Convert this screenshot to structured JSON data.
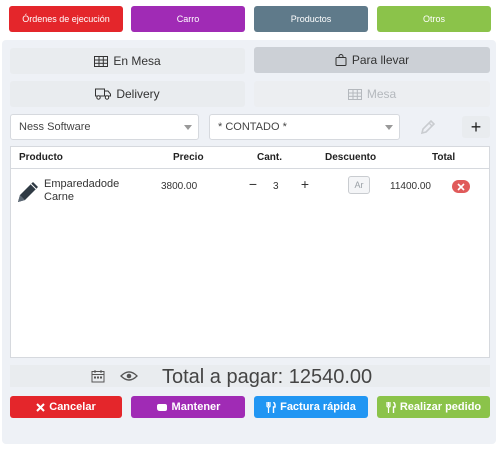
{
  "topbar": {
    "orders_label": "Órdenes de ejecución",
    "cart_label": "Carro",
    "products_label": "Productos",
    "others_label": "Otros"
  },
  "order_type": {
    "dine_in_label": "En Mesa",
    "takeaway_label": "Para llevar",
    "delivery_label": "Delivery",
    "table_label": "Mesa"
  },
  "selects": {
    "customer_value": "Ness Software",
    "payment_value": "* CONTADO *"
  },
  "table": {
    "headers": [
      "Producto",
      "Precio",
      "Cant.",
      "Descuento",
      "Total"
    ],
    "rows": [
      {
        "product": "Emparedadode Carne",
        "price": "3800.00",
        "qty": "3",
        "discount": "Ar",
        "total": "11400.00"
      }
    ]
  },
  "summary": {
    "total_text": "Total a pagar: 12540.00"
  },
  "actions": {
    "cancel_label": "Cancelar",
    "keep_label": "Mantener",
    "quick_invoice_label": "Factura rápida",
    "place_order_label": "Realizar pedido"
  },
  "colors": {
    "red": "#e4262b",
    "purple": "#a02bb5",
    "slate": "#5f7a8a",
    "green": "#8bc34a",
    "blue": "#2196f3"
  }
}
